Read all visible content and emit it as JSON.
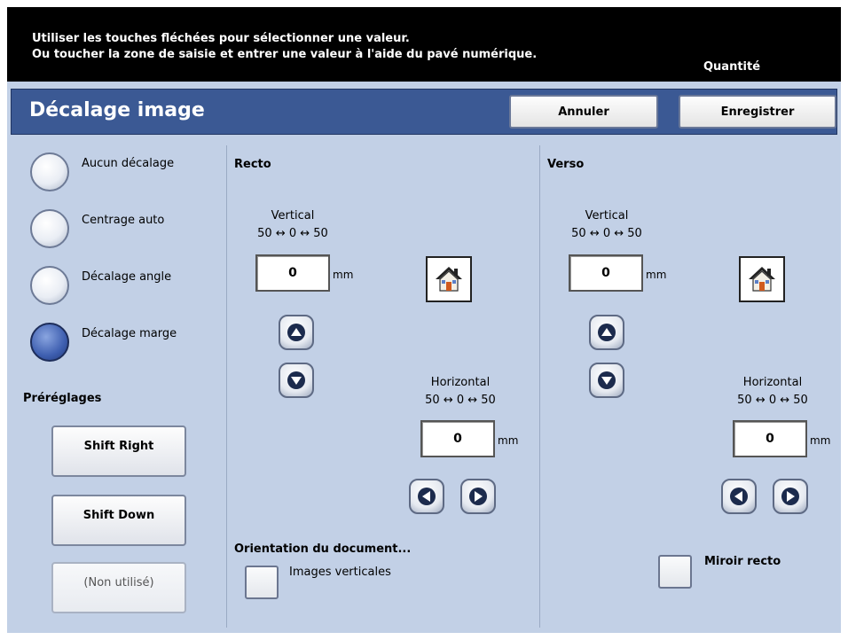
{
  "message": {
    "line1": "Utiliser les touches fléchées pour sélectionner une valeur.",
    "line2": "Ou toucher la zone de saisie et entrer une valeur à l'aide du pavé numérique.",
    "quantity_label": "Quantité"
  },
  "header": {
    "title": "Décalage image",
    "cancel_label": "Annuler",
    "save_label": "Enregistrer",
    "bar_color": "#3b5994"
  },
  "shift_options": [
    {
      "label": "Aucun décalage",
      "selected": false
    },
    {
      "label": "Centrage auto",
      "selected": false
    },
    {
      "label": "Décalage angle",
      "selected": false
    },
    {
      "label": "Décalage marge",
      "selected": true
    }
  ],
  "presets": {
    "heading": "Préréglages",
    "buttons": [
      "Shift Right",
      "Shift Down",
      "(Non utilisé)"
    ]
  },
  "recto": {
    "heading": "Recto",
    "vertical_label": "Vertical",
    "vertical_range": "50 ↔ 0 ↔ 50",
    "vertical_value": "0",
    "horizontal_label": "Horizontal",
    "horizontal_range": "50 ↔ 0 ↔ 50",
    "horizontal_value": "0",
    "unit": "mm"
  },
  "verso": {
    "heading": "Verso",
    "vertical_label": "Vertical",
    "vertical_range": "50 ↔ 0 ↔ 50",
    "vertical_value": "0",
    "horizontal_label": "Horizontal",
    "horizontal_range": "50 ↔ 0 ↔ 50",
    "horizontal_value": "0",
    "unit": "mm"
  },
  "orientation": {
    "heading": "Orientation du document...",
    "option_label": "Images verticales"
  },
  "mirror": {
    "label": "Miroir recto"
  },
  "icons": {
    "home": "home-icon",
    "up": "arrow-up-icon",
    "down": "arrow-down-icon",
    "left": "arrow-left-icon",
    "right": "arrow-right-icon"
  }
}
